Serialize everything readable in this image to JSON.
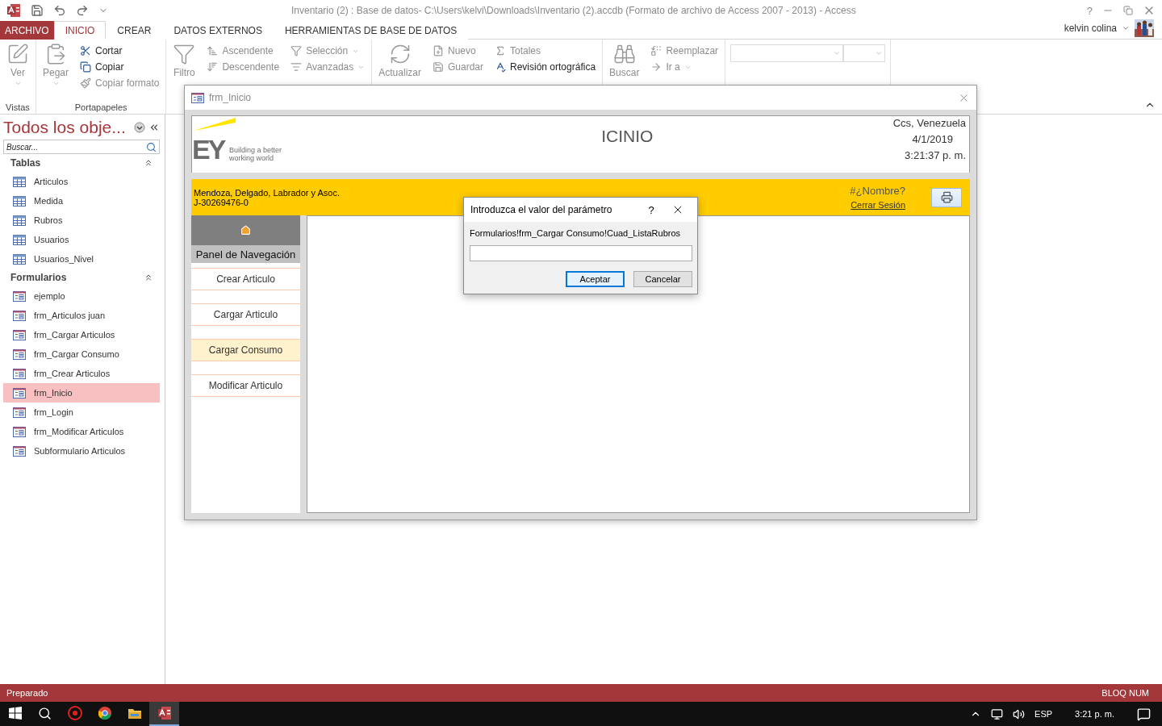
{
  "app": {
    "title": "Inventario (2) : Base de datos- C:\\Users\\kelvi\\Downloads\\Inventario (2).accdb (Formato de archivo de Access 2007 - 2013) - Access",
    "help": "?",
    "user": "kelvin colina"
  },
  "ribbon_tabs": [
    {
      "label": "ARCHIVO",
      "kind": "file",
      "selected": false
    },
    {
      "label": "INICIO",
      "kind": "tab",
      "selected": true
    },
    {
      "label": "CREAR",
      "kind": "tab",
      "selected": false
    },
    {
      "label": "DATOS EXTERNOS",
      "kind": "tab",
      "selected": false
    },
    {
      "label": "HERRAMIENTAS DE BASE DE DATOS",
      "kind": "tab",
      "selected": false
    }
  ],
  "ribbon_groups": [
    {
      "label": "Vistas",
      "large": {
        "label": "Ver",
        "disabled": true,
        "dropdown": true
      }
    },
    {
      "label": "Portapapeles",
      "large": {
        "label": "Pegar",
        "disabled": true,
        "dropdown": true
      },
      "columns": [
        [
          {
            "label": "Cortar",
            "disabled": false,
            "dropdown": false
          },
          {
            "label": "Copiar",
            "disabled": false,
            "dropdown": false
          },
          {
            "label": "Copiar formato",
            "disabled": true,
            "dropdown": false
          }
        ]
      ]
    },
    {
      "large": {
        "label": "Filtro",
        "disabled": true,
        "dropdown": false
      },
      "columns": [
        [
          {
            "label": "Ascendente",
            "disabled": true,
            "dropdown": false
          },
          {
            "label": "Descendente",
            "disabled": true,
            "dropdown": false
          }
        ],
        [
          {
            "label": "Selección",
            "disabled": true,
            "dropdown": true
          },
          {
            "label": "Avanzadas",
            "disabled": true,
            "dropdown": true
          }
        ]
      ]
    },
    {
      "large": {
        "label": "Actualizar",
        "disabled": true,
        "dropdown": false
      },
      "columns": [
        [
          {
            "label": "Nuevo",
            "disabled": true,
            "dropdown": false
          },
          {
            "label": "Guardar",
            "disabled": true,
            "dropdown": false
          }
        ],
        [
          {
            "label": "Totales",
            "disabled": true,
            "dropdown": false
          },
          {
            "label": "Revisión ortográfica",
            "disabled": false,
            "dropdown": false
          }
        ]
      ]
    },
    {
      "large": {
        "label": "Buscar",
        "disabled": true,
        "dropdown": false
      },
      "columns": [
        [
          {
            "label": "Reemplazar",
            "disabled": true,
            "dropdown": false
          },
          {
            "label": "Ir a",
            "disabled": true,
            "dropdown": true
          }
        ]
      ]
    }
  ],
  "nav_pane": {
    "title": "Todos los obje...",
    "search": {
      "placeholder": "Buscar..."
    },
    "sections": [
      {
        "title": "Tablas",
        "kind": "table",
        "items": [
          {
            "label": "Articulos",
            "selected": false
          },
          {
            "label": "Medida",
            "selected": false
          },
          {
            "label": "Rubros",
            "selected": false
          },
          {
            "label": "Usuarios",
            "selected": false
          },
          {
            "label": "Usuarios_Nivel",
            "selected": false
          }
        ]
      },
      {
        "title": "Formularios",
        "kind": "form",
        "items": [
          {
            "label": "ejemplo",
            "selected": false
          },
          {
            "label": "frm_Articulos juan",
            "selected": false
          },
          {
            "label": "frm_Cargar Articulos",
            "selected": false
          },
          {
            "label": "frm_Cargar Consumo",
            "selected": false
          },
          {
            "label": "frm_Crear Articulos",
            "selected": false
          },
          {
            "label": "frm_Inicio",
            "selected": true
          },
          {
            "label": "frm_Login",
            "selected": false
          },
          {
            "label": "frm_Modificar Articulos",
            "selected": false
          },
          {
            "label": "Subformulario Articulos",
            "selected": false
          }
        ]
      }
    ]
  },
  "form_window": {
    "title": "frm_Inicio",
    "header": {
      "logo_mark": "EY",
      "logo_tagline": [
        "Building a better",
        "working world"
      ],
      "heading": "ICINIO",
      "location": "Ccs, Venezuela",
      "date": "4/1/2019",
      "time": "3:21:37 p. m."
    },
    "band": {
      "company": "Mendoza, Delgado, Labrador y Asoc.",
      "rif": "J-30269476-0",
      "user_name": "#¿Nombre?",
      "logout": "Cerrar Sesión"
    },
    "nav": {
      "title": "Panel de Navegación",
      "buttons": [
        {
          "label": "Crear Articulo",
          "selected": false
        },
        {
          "label": "Cargar Articulo",
          "selected": false
        },
        {
          "label": "Cargar Consumo",
          "selected": true
        },
        {
          "label": "Modificar Articulo",
          "selected": false
        }
      ]
    }
  },
  "dialog": {
    "title": "Introduzca el valor del parámetro",
    "help": "?",
    "prompt": "Formularios!frm_Cargar Consumo!Cuad_ListaRubros",
    "buttons": [
      {
        "label": "Aceptar",
        "selected": true
      },
      {
        "label": "Cancelar",
        "selected": false
      }
    ]
  },
  "status_bar": {
    "left": "Preparado",
    "right": "BLOQ NUM"
  },
  "taskbar": {
    "apps": [
      {
        "kind": "security",
        "active": false
      },
      {
        "kind": "browser",
        "active": false
      },
      {
        "kind": "files",
        "active": false
      },
      {
        "kind": "access",
        "active": true
      }
    ],
    "language": "ESP",
    "time": "3:21 p. m."
  }
}
